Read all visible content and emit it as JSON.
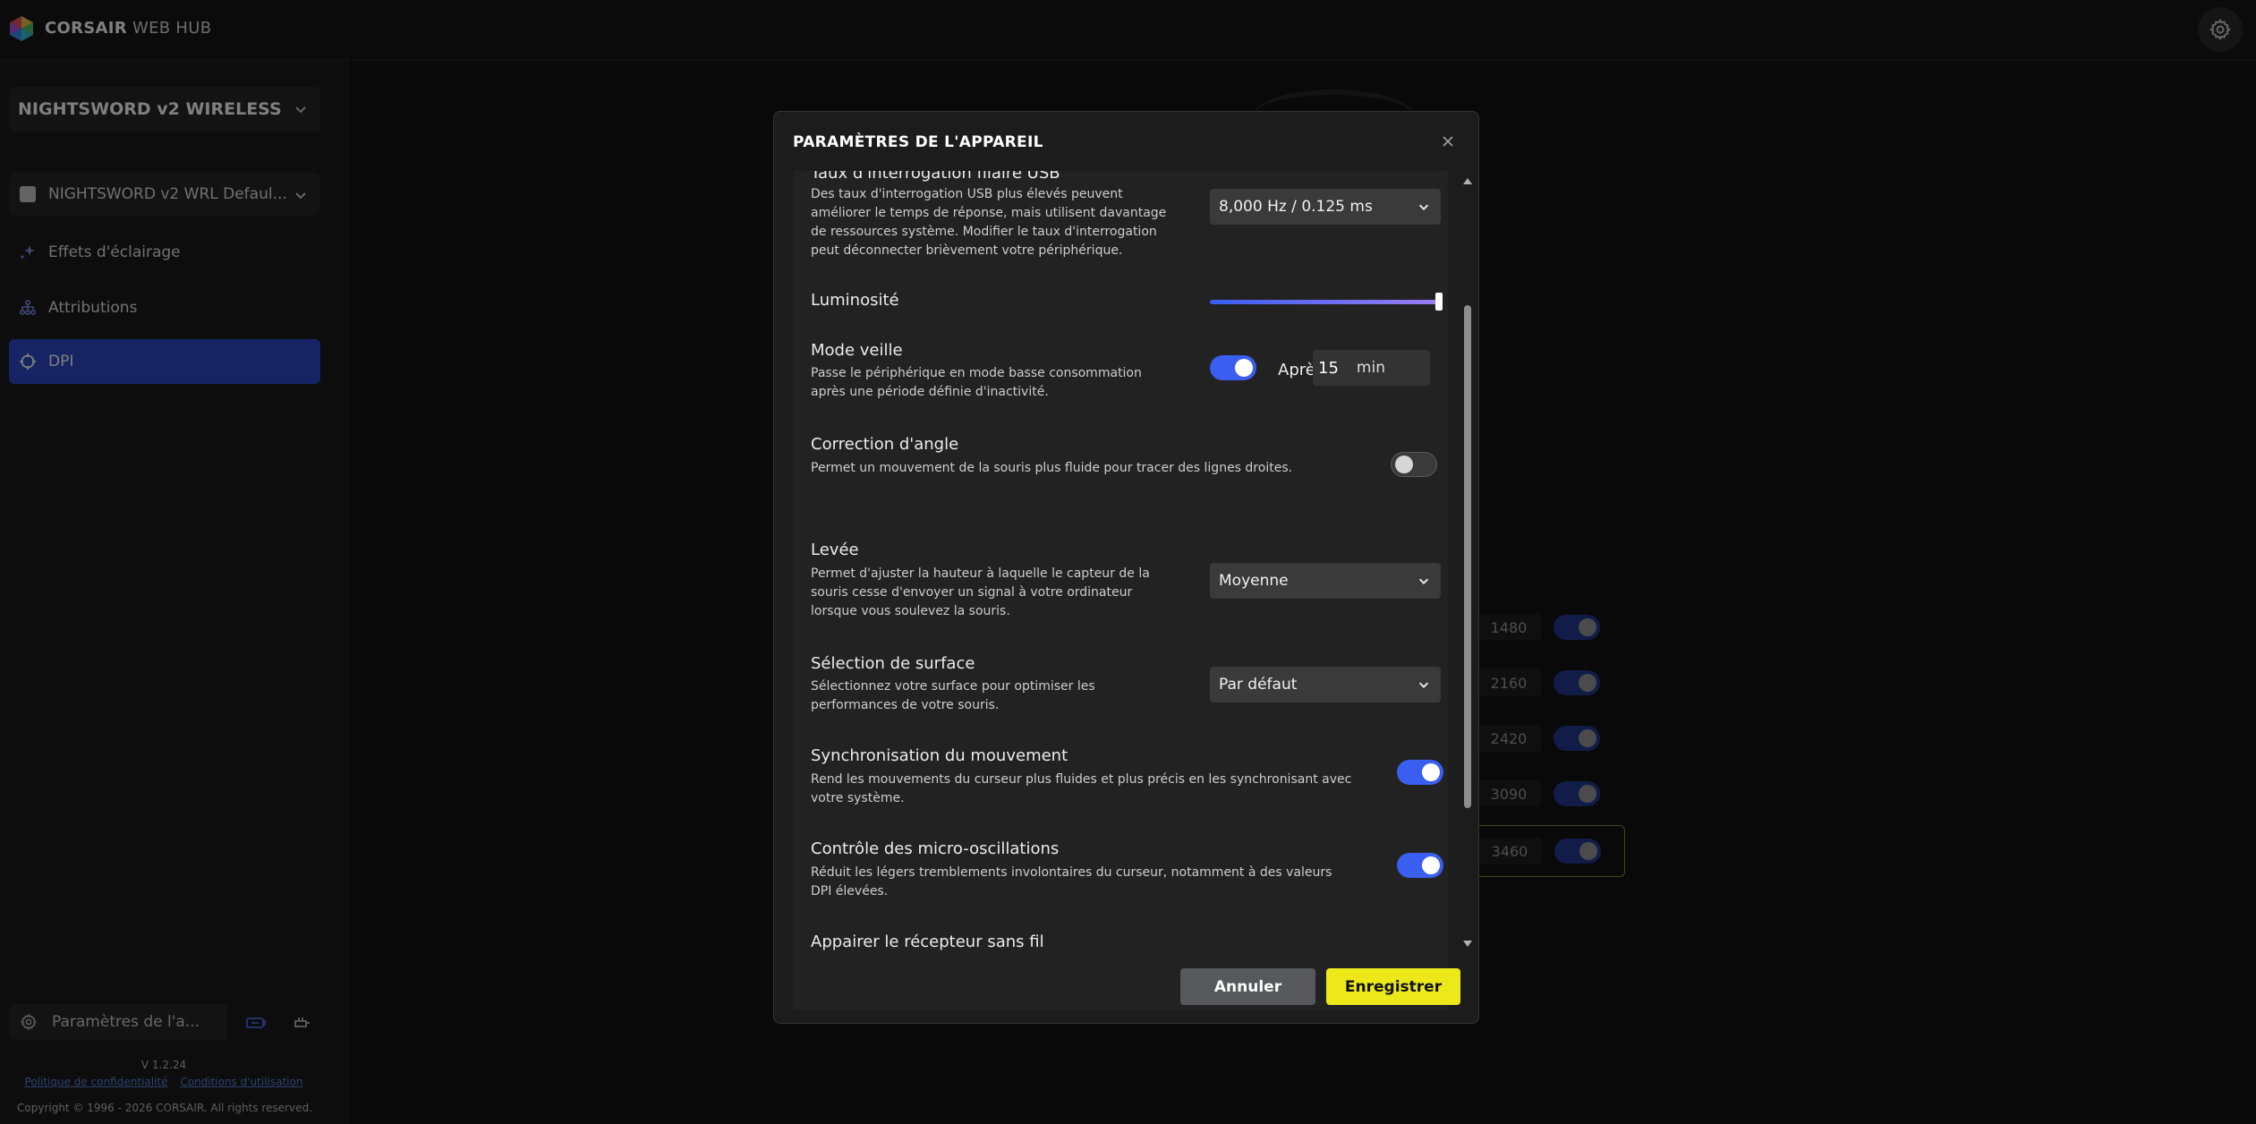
{
  "header": {
    "brand_bold": "CORSAIR",
    "brand_light": "WEB HUB"
  },
  "sidebar": {
    "device_name": "NIGHTSWORD v2 WIRELESS",
    "profile_name": "NIGHTSWORD v2 WRL Defaul...",
    "nav": [
      {
        "label": "Effets d'éclairage",
        "icon": "sparkle-icon"
      },
      {
        "label": "Attributions",
        "icon": "assignments-icon"
      },
      {
        "label": "DPI",
        "icon": "crosshair-icon"
      }
    ],
    "settings_label": "Paramètres de l'a...",
    "version": "V 1.2.24",
    "privacy_link": "Politique de confidentialité",
    "terms_link": "Conditions d'utilisation",
    "copyright": "Copyright © 1996 - 2026 CORSAIR. All rights reserved."
  },
  "background_dpi": [
    "1480",
    "2160",
    "2420",
    "3090",
    "3460"
  ],
  "modal": {
    "title": "PARAMÈTRES DE L'APPAREIL",
    "settings": {
      "usb": {
        "title": "Taux d'interrogation filaire USB",
        "desc": [
          "Des taux d'interrogation USB plus élevés peuvent",
          "améliorer le temps de réponse, mais utilisent davantage",
          "de ressources système. Modifier le taux d'interrogation",
          "peut déconnecter brièvement votre périphérique."
        ],
        "value": "8,000 Hz / 0.125 ms"
      },
      "brightness": {
        "title": "Luminosité",
        "value_percent": 100
      },
      "sleep": {
        "title": "Mode veille",
        "desc": [
          "Passe le périphérique en mode basse consommation",
          "après une période définie d'inactivité."
        ],
        "enabled": true,
        "after_label": "Après",
        "minutes": "15",
        "unit": "min"
      },
      "angle": {
        "title": "Correction d'angle",
        "desc": [
          "Permet un mouvement de la souris plus fluide pour tracer des lignes droites."
        ],
        "enabled": false
      },
      "lift": {
        "title": "Levée",
        "desc": [
          "Permet d'ajuster la hauteur à laquelle le capteur de la",
          "souris cesse d'envoyer un signal à votre ordinateur",
          "lorsque vous soulevez la souris."
        ],
        "value": "Moyenne"
      },
      "surface": {
        "title": "Sélection de surface",
        "desc": [
          "Sélectionnez votre surface pour optimiser les",
          "performances de votre souris."
        ],
        "value": "Par défaut"
      },
      "sync": {
        "title": "Synchronisation du mouvement",
        "desc": [
          "Rend les mouvements du curseur plus fluides et plus précis en les synchronisant avec",
          "votre système."
        ],
        "enabled": true
      },
      "micro": {
        "title": "Contrôle des micro-oscillations",
        "desc": [
          "Réduit les légers tremblements involontaires du curseur, notamment à des valeurs",
          "DPI élevées."
        ],
        "enabled": true
      },
      "pair": {
        "title": "Appairer le récepteur sans fil"
      }
    },
    "cancel_label": "Annuler",
    "save_label": "Enregistrer"
  },
  "colors": {
    "accent_blue": "#2c49c9",
    "toggle_on": "#3a5ef0",
    "save_yellow": "#ece81a"
  }
}
